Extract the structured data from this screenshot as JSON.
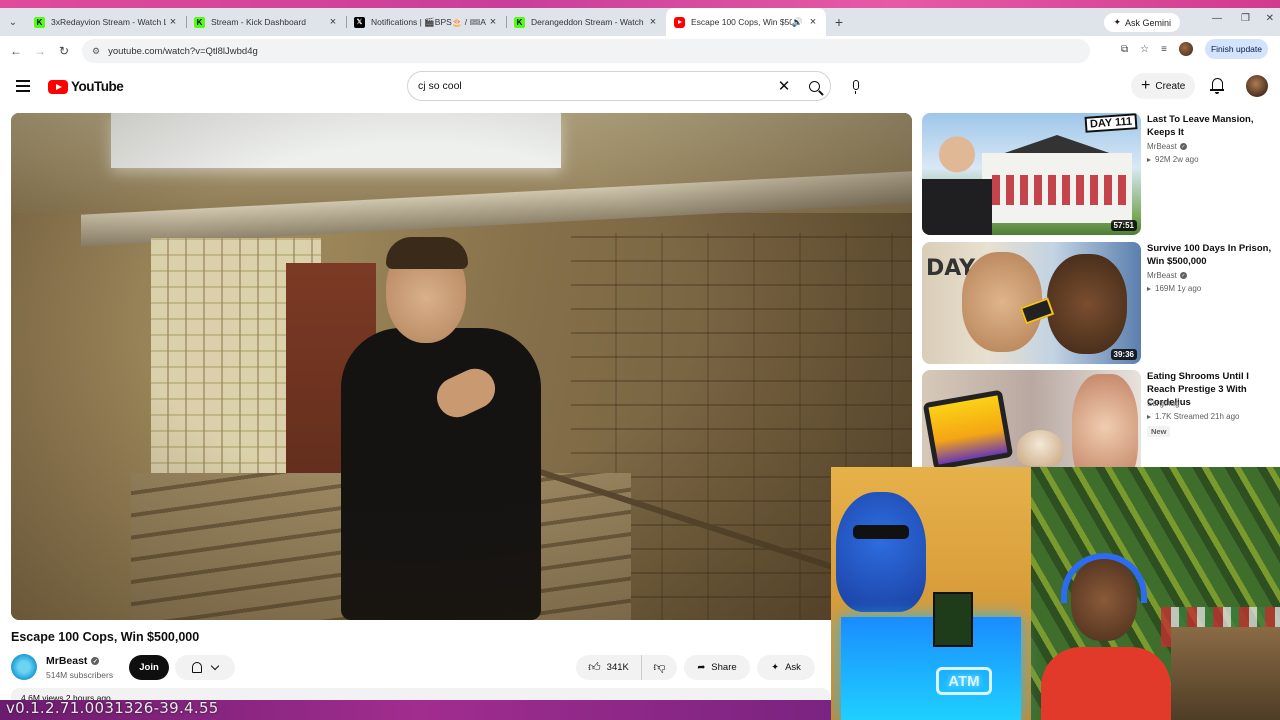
{
  "browser": {
    "tabs": [
      {
        "title": "3xRedayvion Stream - Watch Li",
        "favicon": "kick-icon",
        "active": false
      },
      {
        "title": "Stream - Kick Dashboard",
        "favicon": "kick-icon",
        "active": false
      },
      {
        "title": "Notifications | 🎬BPS🎂 / 🎟AT",
        "favicon": "x-icon",
        "active": false
      },
      {
        "title": "Derangeddon Stream - Watch L",
        "favicon": "kick-icon",
        "active": false
      },
      {
        "title": "Escape 100 Cops, Win $500",
        "favicon": "youtube-icon",
        "active": true
      }
    ],
    "new_tab": "+",
    "gemini_label": "Ask Gemini",
    "url": "youtube.com/watch?v=Qtl8lJwbd4g",
    "finish_update_label": "Finish update"
  },
  "youtube": {
    "logo_text": "YouTube",
    "search": {
      "value": "cj so cool",
      "placeholder": "Search"
    },
    "create_label": "Create",
    "video": {
      "title": "Escape 100 Cops, Win $500,000",
      "channel": "MrBeast",
      "subscribers": "514M subscribers",
      "join_label": "Join",
      "likes": "341K",
      "share_label": "Share",
      "ask_label": "Ask",
      "description_hint": "4.6M views  2 hours ago"
    },
    "recommendations": [
      {
        "title": "Last To Leave Mansion, Keeps It",
        "channel": "MrBeast",
        "verified": true,
        "meta": "92M  2w ago",
        "duration": "57:51",
        "thumb_text": "DAY 111"
      },
      {
        "title": "Survive 100 Days In Prison, Win $500,000",
        "channel": "MrBeast",
        "verified": true,
        "meta": "169M  1y ago",
        "duration": "39:36",
        "thumb_text": "DAY 94"
      },
      {
        "title": "Eating Shrooms Until I Reach Prestige 3 With Cordelius",
        "channel": "Surgthug",
        "verified": false,
        "meta": "1.7K  Streamed 21h ago",
        "badge": "New"
      }
    ]
  },
  "overlay": {
    "version_text": "v0.1.2.71.0031326-39.4.55",
    "atm_sign": "ATM"
  }
}
